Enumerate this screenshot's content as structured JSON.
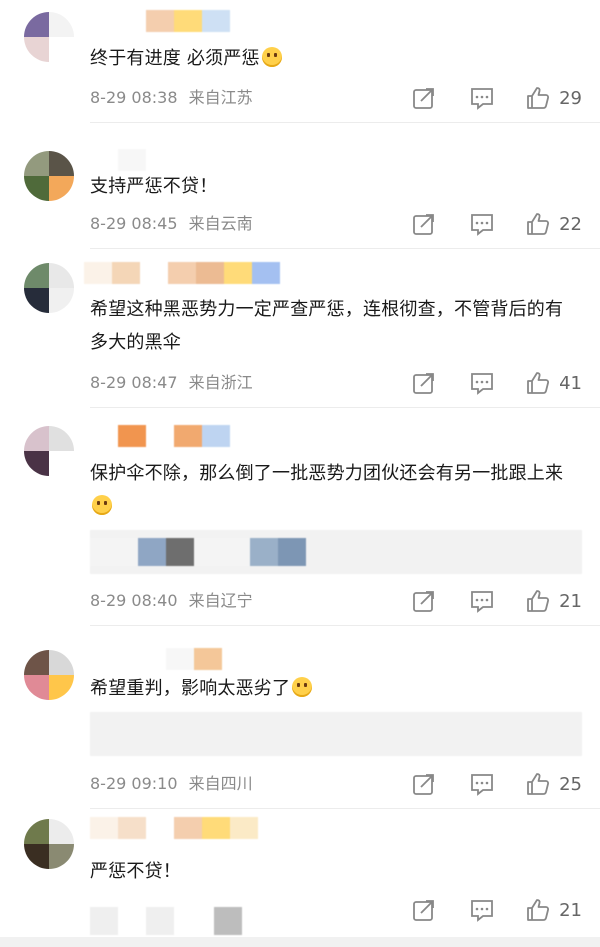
{
  "comments": [
    {
      "text": "终于有进度 必须严惩",
      "date": "8-29 08:38",
      "location": "来自江苏",
      "likes": "29",
      "emoji": "angry-emoji",
      "avatar_colors": [
        "#7a6aa0",
        "#f3f3f3",
        "#e8d4d4",
        "#ffffff"
      ],
      "name_colors": [
        "#ffffff",
        "#f3c9a6",
        "#ffd86b",
        "#c9ddf3"
      ]
    },
    {
      "text": "支持严惩不贷！",
      "date": "8-29 08:45",
      "location": "来自云南",
      "likes": "22",
      "avatar_colors": [
        "#939a7e",
        "#5a5448",
        "#4f6a3a",
        "#f3a85a"
      ],
      "name_colors": [
        "#ffffff",
        "#f7f7f7"
      ]
    },
    {
      "text": "希望这种黑恶势力一定严查严惩，连根彻查，不管背后的有多大的黑伞",
      "date": "8-29 08:47",
      "location": "来自浙江",
      "likes": "41",
      "avatar_colors": [
        "#6e8a6a",
        "#e8e8e8",
        "#262c3a",
        "#f0f0f0"
      ],
      "name_colors": [
        "#fbf1e6",
        "#f3d2b0",
        "#ffffff",
        "#f3c9a6",
        "#eab488",
        "#ffd86b",
        "#9bbaf0"
      ]
    },
    {
      "text": "保护伞不除，那么倒了一批恶势力团伙还会有另一批跟上来",
      "date": "8-29 08:40",
      "location": "来自辽宁",
      "likes": "21",
      "emoji": "thinking-emoji",
      "avatar_colors": [
        "#d8c2cc",
        "#e0e0e0",
        "#4a3346",
        "#ffffff"
      ],
      "name_colors": [
        "#ffffff",
        "#f08a3c",
        "#ffffff",
        "#f0a060",
        "#b8d0f0"
      ],
      "quote_colors": [
        "#f4f4f4",
        "#8fa6c4",
        "#6e6e6e",
        "#f4f4f4",
        "#9ab0c8",
        "#7d96b4"
      ]
    },
    {
      "text": "希望重判，影响太恶劣了",
      "date": "8-29 09:10",
      "location": "来自四川",
      "likes": "25",
      "emoji": "smile-emoji",
      "avatar_colors": [
        "#6e5448",
        "#d8d8d8",
        "#e08a96",
        "#ffc64a"
      ],
      "name_colors": [
        "#ffffff",
        "#ffffff",
        "#f7f7f7",
        "#f3c28e"
      ]
    },
    {
      "text": "严惩不贷！",
      "date": "",
      "location": "",
      "likes": "21",
      "avatar_colors": [
        "#6f7a4c",
        "#ececec",
        "#3a2e22",
        "#8a8a72"
      ],
      "name_colors": [
        "#fbf1e6",
        "#f6dcc4",
        "#ffffff",
        "#f3c9a6",
        "#ffd86b",
        "#fbe8c0"
      ],
      "quote_colors": [
        "#efefef",
        "#ffffff",
        "#efefef",
        "#ffffff",
        "#bdbdbd"
      ]
    }
  ],
  "icons": {
    "share": "share-icon",
    "reply": "reply-icon",
    "like": "thumbs-up-icon"
  }
}
